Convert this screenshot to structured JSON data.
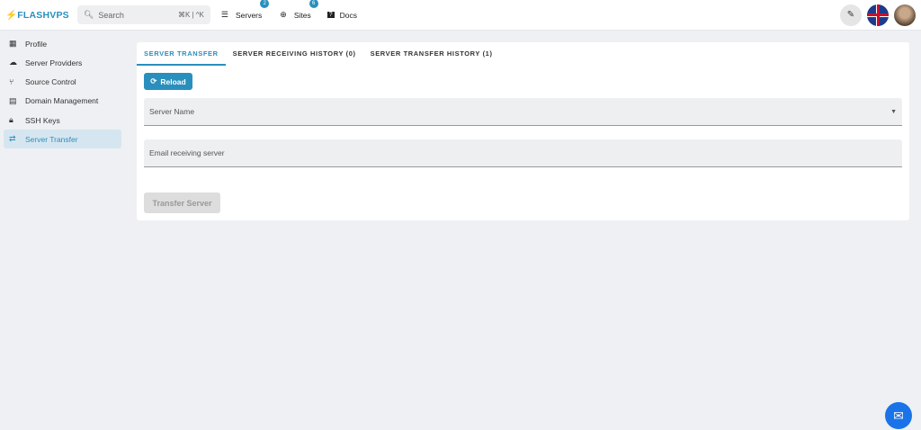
{
  "header": {
    "logo_bolt": "⚡",
    "logo": "FLASHVPS",
    "search_placeholder": "Search",
    "search_shortcut": "⌘K | ^K",
    "nav": [
      {
        "label": "Servers",
        "badge": "2"
      },
      {
        "label": "Sites",
        "badge": "6"
      },
      {
        "label": "Docs"
      }
    ]
  },
  "sidebar": {
    "items": [
      {
        "label": "Profile"
      },
      {
        "label": "Server Providers"
      },
      {
        "label": "Source Control"
      },
      {
        "label": "Domain Management"
      },
      {
        "label": "SSH Keys"
      },
      {
        "label": "Server Transfer"
      }
    ]
  },
  "main": {
    "tabs": [
      {
        "label": "SERVER TRANSFER"
      },
      {
        "label": "SERVER RECEIVING HISTORY (0)"
      },
      {
        "label": "SERVER TRANSFER HISTORY (1)"
      }
    ],
    "reload_label": "Reload",
    "server_name_label": "Server Name",
    "email_label": "Email receiving server",
    "transfer_label": "Transfer Server"
  },
  "colors": {
    "accent": "#2a8fbd"
  }
}
